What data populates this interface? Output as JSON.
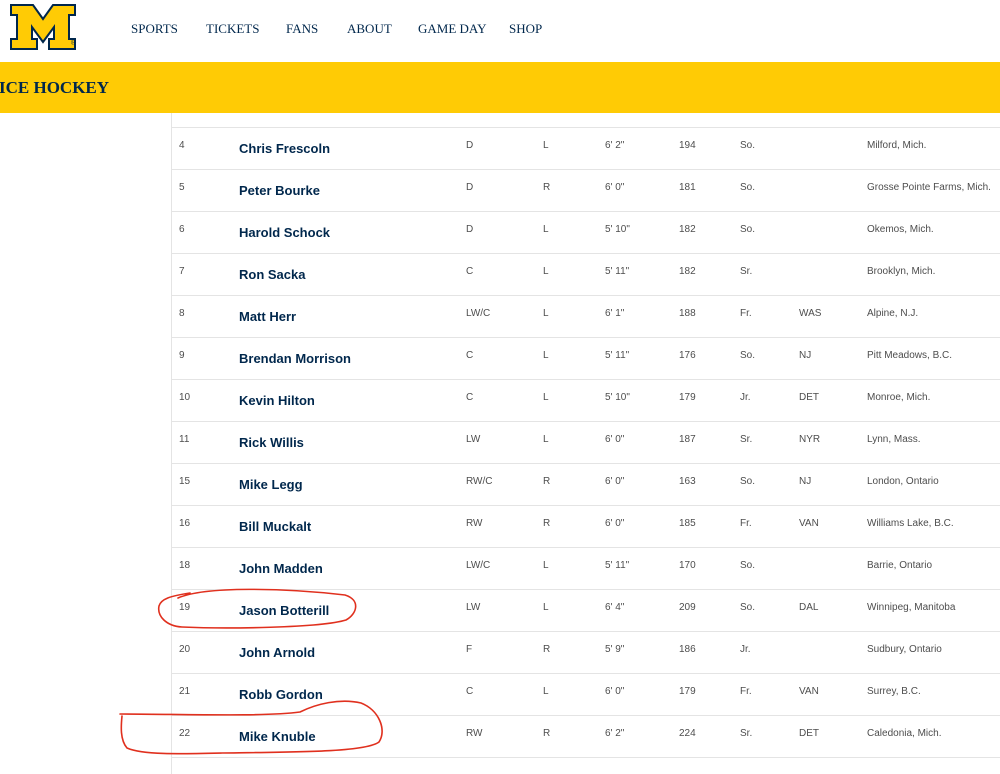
{
  "colors": {
    "maize": "#FFCB05",
    "navy": "#00274C",
    "annotation_red": "#E0301E",
    "row_border": "#E4E4E4"
  },
  "icons": {
    "logo": "block-m-logo"
  },
  "header": {
    "logo": {
      "mark": "®"
    },
    "nav": [
      {
        "label": "SPORTS"
      },
      {
        "label": "TICKETS"
      },
      {
        "label": "FANS"
      },
      {
        "label": "ABOUT"
      },
      {
        "label": "GAME DAY"
      },
      {
        "label": "SHOP"
      }
    ]
  },
  "banner": {
    "title": "ICE HOCKEY"
  },
  "roster": {
    "rows": [
      {
        "number": "4",
        "name": "Chris Frescoln",
        "position": "D",
        "shoots": "L",
        "height": "6' 2\"",
        "weight": "194",
        "class": "So.",
        "draft": "",
        "hometown": "Milford, Mich."
      },
      {
        "number": "5",
        "name": "Peter Bourke",
        "position": "D",
        "shoots": "R",
        "height": "6' 0\"",
        "weight": "181",
        "class": "So.",
        "draft": "",
        "hometown": "Grosse Pointe Farms, Mich."
      },
      {
        "number": "6",
        "name": "Harold Schock",
        "position": "D",
        "shoots": "L",
        "height": "5' 10\"",
        "weight": "182",
        "class": "So.",
        "draft": "",
        "hometown": "Okemos, Mich."
      },
      {
        "number": "7",
        "name": "Ron Sacka",
        "position": "C",
        "shoots": "L",
        "height": "5' 11\"",
        "weight": "182",
        "class": "Sr.",
        "draft": "",
        "hometown": "Brooklyn, Mich."
      },
      {
        "number": "8",
        "name": "Matt Herr",
        "position": "LW/C",
        "shoots": "L",
        "height": "6' 1\"",
        "weight": "188",
        "class": "Fr.",
        "draft": "WAS",
        "hometown": "Alpine, N.J."
      },
      {
        "number": "9",
        "name": "Brendan Morrison",
        "position": "C",
        "shoots": "L",
        "height": "5' 11\"",
        "weight": "176",
        "class": "So.",
        "draft": "NJ",
        "hometown": "Pitt Meadows, B.C."
      },
      {
        "number": "10",
        "name": "Kevin Hilton",
        "position": "C",
        "shoots": "L",
        "height": "5' 10\"",
        "weight": "179",
        "class": "Jr.",
        "draft": "DET",
        "hometown": "Monroe, Mich."
      },
      {
        "number": "11",
        "name": "Rick Willis",
        "position": "LW",
        "shoots": "L",
        "height": "6' 0\"",
        "weight": "187",
        "class": "Sr.",
        "draft": "NYR",
        "hometown": "Lynn, Mass."
      },
      {
        "number": "15",
        "name": "Mike Legg",
        "position": "RW/C",
        "shoots": "R",
        "height": "6' 0\"",
        "weight": "163",
        "class": "So.",
        "draft": "NJ",
        "hometown": "London, Ontario"
      },
      {
        "number": "16",
        "name": "Bill Muckalt",
        "position": "RW",
        "shoots": "R",
        "height": "6' 0\"",
        "weight": "185",
        "class": "Fr.",
        "draft": "VAN",
        "hometown": "Williams Lake, B.C."
      },
      {
        "number": "18",
        "name": "John Madden",
        "position": "LW/C",
        "shoots": "L",
        "height": "5' 11\"",
        "weight": "170",
        "class": "So.",
        "draft": "",
        "hometown": "Barrie, Ontario"
      },
      {
        "number": "19",
        "name": "Jason Botterill",
        "position": "LW",
        "shoots": "L",
        "height": "6' 4\"",
        "weight": "209",
        "class": "So.",
        "draft": "DAL",
        "hometown": "Winnipeg, Manitoba"
      },
      {
        "number": "20",
        "name": "John Arnold",
        "position": "F",
        "shoots": "R",
        "height": "5' 9\"",
        "weight": "186",
        "class": "Jr.",
        "draft": "",
        "hometown": "Sudbury, Ontario"
      },
      {
        "number": "21",
        "name": "Robb Gordon",
        "position": "C",
        "shoots": "L",
        "height": "6' 0\"",
        "weight": "179",
        "class": "Fr.",
        "draft": "VAN",
        "hometown": "Surrey, B.C."
      },
      {
        "number": "22",
        "name": "Mike Knuble",
        "position": "RW",
        "shoots": "R",
        "height": "6' 2\"",
        "weight": "224",
        "class": "Sr.",
        "draft": "DET",
        "hometown": "Caledonia, Mich."
      }
    ]
  }
}
